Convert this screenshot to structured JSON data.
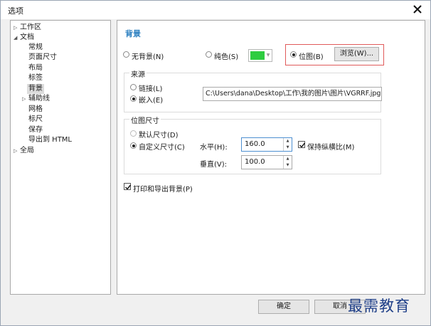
{
  "window": {
    "title": "选项"
  },
  "tree": {
    "items": [
      {
        "label": "工作区",
        "expander": "▷",
        "indent": 0
      },
      {
        "label": "文档",
        "expander": "◢",
        "indent": 0
      },
      {
        "label": "常规",
        "expander": "",
        "indent": 2
      },
      {
        "label": "页面尺寸",
        "expander": "",
        "indent": 2
      },
      {
        "label": "布局",
        "expander": "",
        "indent": 2
      },
      {
        "label": "标签",
        "expander": "",
        "indent": 2
      },
      {
        "label": "背景",
        "expander": "",
        "indent": 2,
        "selected": true
      },
      {
        "label": "辅助线",
        "expander": "▷",
        "indent": 1
      },
      {
        "label": "网格",
        "expander": "",
        "indent": 2
      },
      {
        "label": "标尺",
        "expander": "",
        "indent": 2
      },
      {
        "label": "保存",
        "expander": "",
        "indent": 2
      },
      {
        "label": "导出到 HTML",
        "expander": "",
        "indent": 2
      },
      {
        "label": "全局",
        "expander": "▷",
        "indent": 0
      }
    ]
  },
  "panel": {
    "title": "背景",
    "bg_type": {
      "none_label": "无背景(N)",
      "solid_label": "纯色(S)",
      "solid_color": "#2ecc40",
      "bitmap_label": "位图(B)",
      "selected": "bitmap"
    },
    "browse_label": "浏览(W)...",
    "source": {
      "title": "来源",
      "link_label": "链接(L)",
      "embed_label": "嵌入(E)",
      "selected": "embed",
      "path": "C:\\Users\\dana\\Desktop\\工作\\我的图片\\图片\\VGRRF.jpg"
    },
    "bitmap_size": {
      "title": "位图尺寸",
      "default_label": "默认尺寸(D)",
      "custom_label": "自定义尺寸(C)",
      "selected": "custom",
      "horizontal_label": "水平(H):",
      "horizontal_value": "160.0",
      "vertical_label": "垂直(V):",
      "vertical_value": "100.0",
      "keep_ratio_label": "保持纵横比(M)",
      "keep_ratio_checked": true
    },
    "print_export_label": "打印和导出背景(P)",
    "print_export_checked": true
  },
  "footer": {
    "ok_label": "确定",
    "cancel_label": "取消"
  },
  "watermark": "最需教育",
  "colors": {
    "accent_title": "#2b7fc0",
    "highlight_border": "#e05a5a",
    "watermark": "#1f3f88"
  }
}
